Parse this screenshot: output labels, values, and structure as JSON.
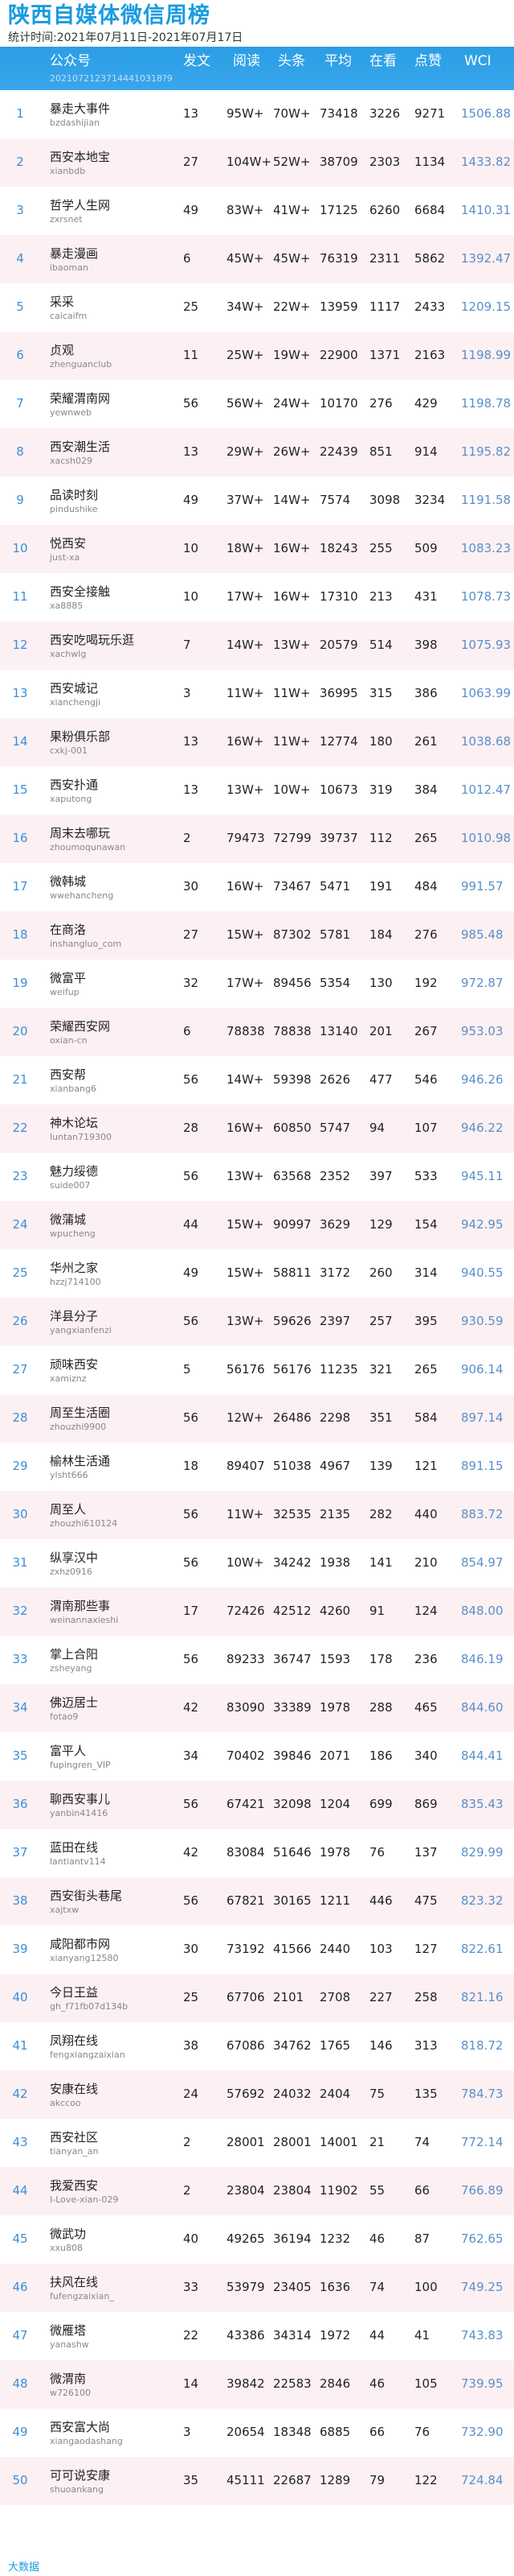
{
  "header": {
    "title": "陕西自媒体微信周榜",
    "subtitle": "统计时间:2021年07月11日-2021年07月17日"
  },
  "columns": [
    "公众号",
    "发文",
    "阅读",
    "头条",
    "平均",
    "在看",
    "点赞",
    "WCI"
  ],
  "header_code": "20210721237144410318?9",
  "rows": [
    {
      "rank": "1",
      "name": "暴走大事件",
      "account": "bzdashijian",
      "posts": "13",
      "reads": "95W+",
      "headline": "70W+",
      "avg": "73418",
      "watching": "3226",
      "likes": "9271",
      "wci": "1506.88"
    },
    {
      "rank": "2",
      "name": "西安本地宝",
      "account": "xianbdb",
      "posts": "27",
      "reads": "104W+",
      "headline": "52W+",
      "avg": "38709",
      "watching": "2303",
      "likes": "1134",
      "wci": "1433.82"
    },
    {
      "rank": "3",
      "name": "哲学人生网",
      "account": "zxrsnet",
      "posts": "49",
      "reads": "83W+",
      "headline": "41W+",
      "avg": "17125",
      "watching": "6260",
      "likes": "6684",
      "wci": "1410.31"
    },
    {
      "rank": "4",
      "name": "暴走漫画",
      "account": "ibaoman",
      "posts": "6",
      "reads": "45W+",
      "headline": "45W+",
      "avg": "76319",
      "watching": "2311",
      "likes": "5862",
      "wci": "1392.47"
    },
    {
      "rank": "5",
      "name": "采采",
      "account": "caicaifm",
      "posts": "25",
      "reads": "34W+",
      "headline": "22W+",
      "avg": "13959",
      "watching": "1117",
      "likes": "2433",
      "wci": "1209.15"
    },
    {
      "rank": "6",
      "name": "贞观",
      "account": "zhenguanclub",
      "posts": "11",
      "reads": "25W+",
      "headline": "19W+",
      "avg": "22900",
      "watching": "1371",
      "likes": "2163",
      "wci": "1198.99"
    },
    {
      "rank": "7",
      "name": "荣耀渭南网",
      "account": "yewnweb",
      "posts": "56",
      "reads": "56W+",
      "headline": "24W+",
      "avg": "10170",
      "watching": "276",
      "likes": "429",
      "wci": "1198.78"
    },
    {
      "rank": "8",
      "name": "西安潮生活",
      "account": "xacsh029",
      "posts": "13",
      "reads": "29W+",
      "headline": "26W+",
      "avg": "22439",
      "watching": "851",
      "likes": "914",
      "wci": "1195.82"
    },
    {
      "rank": "9",
      "name": "品读时刻",
      "account": "pindushike",
      "posts": "49",
      "reads": "37W+",
      "headline": "14W+",
      "avg": "7574",
      "watching": "3098",
      "likes": "3234",
      "wci": "1191.58"
    },
    {
      "rank": "10",
      "name": "悦西安",
      "account": "just-xa",
      "posts": "10",
      "reads": "18W+",
      "headline": "16W+",
      "avg": "18243",
      "watching": "255",
      "likes": "509",
      "wci": "1083.23"
    },
    {
      "rank": "11",
      "name": "西安全接触",
      "account": "xa8885",
      "posts": "10",
      "reads": "17W+",
      "headline": "16W+",
      "avg": "17310",
      "watching": "213",
      "likes": "431",
      "wci": "1078.73"
    },
    {
      "rank": "12",
      "name": "西安吃喝玩乐逛",
      "account": "xachwlg",
      "posts": "7",
      "reads": "14W+",
      "headline": "13W+",
      "avg": "20579",
      "watching": "514",
      "likes": "398",
      "wci": "1075.93"
    },
    {
      "rank": "13",
      "name": "西安城记",
      "account": "xianchengji",
      "posts": "3",
      "reads": "11W+",
      "headline": "11W+",
      "avg": "36995",
      "watching": "315",
      "likes": "386",
      "wci": "1063.99"
    },
    {
      "rank": "14",
      "name": "果粉俱乐部",
      "account": "cxkj-001",
      "posts": "13",
      "reads": "16W+",
      "headline": "11W+",
      "avg": "12774",
      "watching": "180",
      "likes": "261",
      "wci": "1038.68"
    },
    {
      "rank": "15",
      "name": "西安扑通",
      "account": "xaputong",
      "posts": "13",
      "reads": "13W+",
      "headline": "10W+",
      "avg": "10673",
      "watching": "319",
      "likes": "384",
      "wci": "1012.47"
    },
    {
      "rank": "16",
      "name": "周末去哪玩",
      "account": "zhoumoqunawan",
      "posts": "2",
      "reads": "79473",
      "headline": "72799",
      "avg": "39737",
      "watching": "112",
      "likes": "265",
      "wci": "1010.98"
    },
    {
      "rank": "17",
      "name": "微韩城",
      "account": "wwehancheng",
      "posts": "30",
      "reads": "16W+",
      "headline": "73467",
      "avg": "5471",
      "watching": "191",
      "likes": "484",
      "wci": "991.57"
    },
    {
      "rank": "18",
      "name": "在商洛",
      "account": "inshangluo_com",
      "posts": "27",
      "reads": "15W+",
      "headline": "87302",
      "avg": "5781",
      "watching": "184",
      "likes": "276",
      "wci": "985.48"
    },
    {
      "rank": "19",
      "name": "微富平",
      "account": "weifup",
      "posts": "32",
      "reads": "17W+",
      "headline": "89456",
      "avg": "5354",
      "watching": "130",
      "likes": "192",
      "wci": "972.87"
    },
    {
      "rank": "20",
      "name": "荣耀西安网",
      "account": "oxian-cn",
      "posts": "6",
      "reads": "78838",
      "headline": "78838",
      "avg": "13140",
      "watching": "201",
      "likes": "267",
      "wci": "953.03"
    },
    {
      "rank": "21",
      "name": "西安帮",
      "account": "xianbang6",
      "posts": "56",
      "reads": "14W+",
      "headline": "59398",
      "avg": "2626",
      "watching": "477",
      "likes": "546",
      "wci": "946.26"
    },
    {
      "rank": "22",
      "name": "神木论坛",
      "account": "luntan719300",
      "posts": "28",
      "reads": "16W+",
      "headline": "60850",
      "avg": "5747",
      "watching": "94",
      "likes": "107",
      "wci": "946.22"
    },
    {
      "rank": "23",
      "name": "魅力绥德",
      "account": "suide007",
      "posts": "56",
      "reads": "13W+",
      "headline": "63568",
      "avg": "2352",
      "watching": "397",
      "likes": "533",
      "wci": "945.11"
    },
    {
      "rank": "24",
      "name": "微蒲城",
      "account": "wpucheng",
      "posts": "44",
      "reads": "15W+",
      "headline": "90997",
      "avg": "3629",
      "watching": "129",
      "likes": "154",
      "wci": "942.95"
    },
    {
      "rank": "25",
      "name": "华州之家",
      "account": "hzzj714100",
      "posts": "49",
      "reads": "15W+",
      "headline": "58811",
      "avg": "3172",
      "watching": "260",
      "likes": "314",
      "wci": "940.55"
    },
    {
      "rank": "26",
      "name": "洋县分子",
      "account": "yangxianfenzi",
      "posts": "56",
      "reads": "13W+",
      "headline": "59626",
      "avg": "2397",
      "watching": "257",
      "likes": "395",
      "wci": "930.59"
    },
    {
      "rank": "27",
      "name": "顽味西安",
      "account": "xamiznz",
      "posts": "5",
      "reads": "56176",
      "headline": "56176",
      "avg": "11235",
      "watching": "321",
      "likes": "265",
      "wci": "906.14"
    },
    {
      "rank": "28",
      "name": "周至生活圈",
      "account": "zhouzhi9900",
      "posts": "56",
      "reads": "12W+",
      "headline": "26486",
      "avg": "2298",
      "watching": "351",
      "likes": "584",
      "wci": "897.14"
    },
    {
      "rank": "29",
      "name": "榆林生活通",
      "account": "ylsht666",
      "posts": "18",
      "reads": "89407",
      "headline": "51038",
      "avg": "4967",
      "watching": "139",
      "likes": "121",
      "wci": "891.15"
    },
    {
      "rank": "30",
      "name": "周至人",
      "account": "zhouzhi610124",
      "posts": "56",
      "reads": "11W+",
      "headline": "32535",
      "avg": "2135",
      "watching": "282",
      "likes": "440",
      "wci": "883.72"
    },
    {
      "rank": "31",
      "name": "纵享汉中",
      "account": "zxhz0916",
      "posts": "56",
      "reads": "10W+",
      "headline": "34242",
      "avg": "1938",
      "watching": "141",
      "likes": "210",
      "wci": "854.97"
    },
    {
      "rank": "32",
      "name": "渭南那些事",
      "account": "weinannaxieshi",
      "posts": "17",
      "reads": "72426",
      "headline": "42512",
      "avg": "4260",
      "watching": "91",
      "likes": "124",
      "wci": "848.00"
    },
    {
      "rank": "33",
      "name": "掌上合阳",
      "account": "zsheyang",
      "posts": "56",
      "reads": "89233",
      "headline": "36747",
      "avg": "1593",
      "watching": "178",
      "likes": "236",
      "wci": "846.19"
    },
    {
      "rank": "34",
      "name": "佛迈居士",
      "account": "fotao9",
      "posts": "42",
      "reads": "83090",
      "headline": "33389",
      "avg": "1978",
      "watching": "288",
      "likes": "465",
      "wci": "844.60"
    },
    {
      "rank": "35",
      "name": "富平人",
      "account": "fupingren_VIP",
      "posts": "34",
      "reads": "70402",
      "headline": "39846",
      "avg": "2071",
      "watching": "186",
      "likes": "340",
      "wci": "844.41"
    },
    {
      "rank": "36",
      "name": "聊西安事儿",
      "account": "yanbin41416",
      "posts": "56",
      "reads": "67421",
      "headline": "32098",
      "avg": "1204",
      "watching": "699",
      "likes": "869",
      "wci": "835.43"
    },
    {
      "rank": "37",
      "name": "蓝田在线",
      "account": "lantiantv114",
      "posts": "42",
      "reads": "83084",
      "headline": "51646",
      "avg": "1978",
      "watching": "76",
      "likes": "137",
      "wci": "829.99"
    },
    {
      "rank": "38",
      "name": "西安街头巷尾",
      "account": "xajtxw",
      "posts": "56",
      "reads": "67821",
      "headline": "30165",
      "avg": "1211",
      "watching": "446",
      "likes": "475",
      "wci": "823.32"
    },
    {
      "rank": "39",
      "name": "咸阳都市网",
      "account": "xianyang12580",
      "posts": "30",
      "reads": "73192",
      "headline": "41566",
      "avg": "2440",
      "watching": "103",
      "likes": "127",
      "wci": "822.61"
    },
    {
      "rank": "40",
      "name": "今日王益",
      "account": "gh_f71fb07d134b",
      "posts": "25",
      "reads": "67706",
      "headline": "2101",
      "avg": "2708",
      "watching": "227",
      "likes": "258",
      "wci": "821.16"
    },
    {
      "rank": "41",
      "name": "凤翔在线",
      "account": "fengxiangzaixian",
      "posts": "38",
      "reads": "67086",
      "headline": "34762",
      "avg": "1765",
      "watching": "146",
      "likes": "313",
      "wci": "818.72"
    },
    {
      "rank": "42",
      "name": "安康在线",
      "account": "akccoo",
      "posts": "24",
      "reads": "57692",
      "headline": "24032",
      "avg": "2404",
      "watching": "75",
      "likes": "135",
      "wci": "784.73"
    },
    {
      "rank": "43",
      "name": "西安社区",
      "account": "tianyan_an",
      "posts": "2",
      "reads": "28001",
      "headline": "28001",
      "avg": "14001",
      "watching": "21",
      "likes": "74",
      "wci": "772.14"
    },
    {
      "rank": "44",
      "name": "我爱西安",
      "account": "I-Love-xian-029",
      "posts": "2",
      "reads": "23804",
      "headline": "23804",
      "avg": "11902",
      "watching": "55",
      "likes": "66",
      "wci": "766.89"
    },
    {
      "rank": "45",
      "name": "微武功",
      "account": "xxu808",
      "posts": "40",
      "reads": "49265",
      "headline": "36194",
      "avg": "1232",
      "watching": "46",
      "likes": "87",
      "wci": "762.65"
    },
    {
      "rank": "46",
      "name": "扶风在线",
      "account": "fufengzaixian_",
      "posts": "33",
      "reads": "53979",
      "headline": "23405",
      "avg": "1636",
      "watching": "74",
      "likes": "100",
      "wci": "749.25"
    },
    {
      "rank": "47",
      "name": "微雁塔",
      "account": "yanashw",
      "posts": "22",
      "reads": "43386",
      "headline": "34314",
      "avg": "1972",
      "watching": "44",
      "likes": "41",
      "wci": "743.83"
    },
    {
      "rank": "48",
      "name": "微渭南",
      "account": "w726100",
      "posts": "14",
      "reads": "39842",
      "headline": "22583",
      "avg": "2846",
      "watching": "46",
      "likes": "105",
      "wci": "739.95"
    },
    {
      "rank": "49",
      "name": "西安富大尚",
      "account": "xiangaodashang",
      "posts": "3",
      "reads": "20654",
      "headline": "18348",
      "avg": "6885",
      "watching": "66",
      "likes": "76",
      "wci": "732.90"
    },
    {
      "rank": "50",
      "name": "可可说安康",
      "account": "shuoankang",
      "posts": "35",
      "reads": "45111",
      "headline": "22687",
      "avg": "1289",
      "watching": "79",
      "likes": "122",
      "wci": "724.84"
    }
  ],
  "footer": {
    "logo_text": "大数据"
  }
}
